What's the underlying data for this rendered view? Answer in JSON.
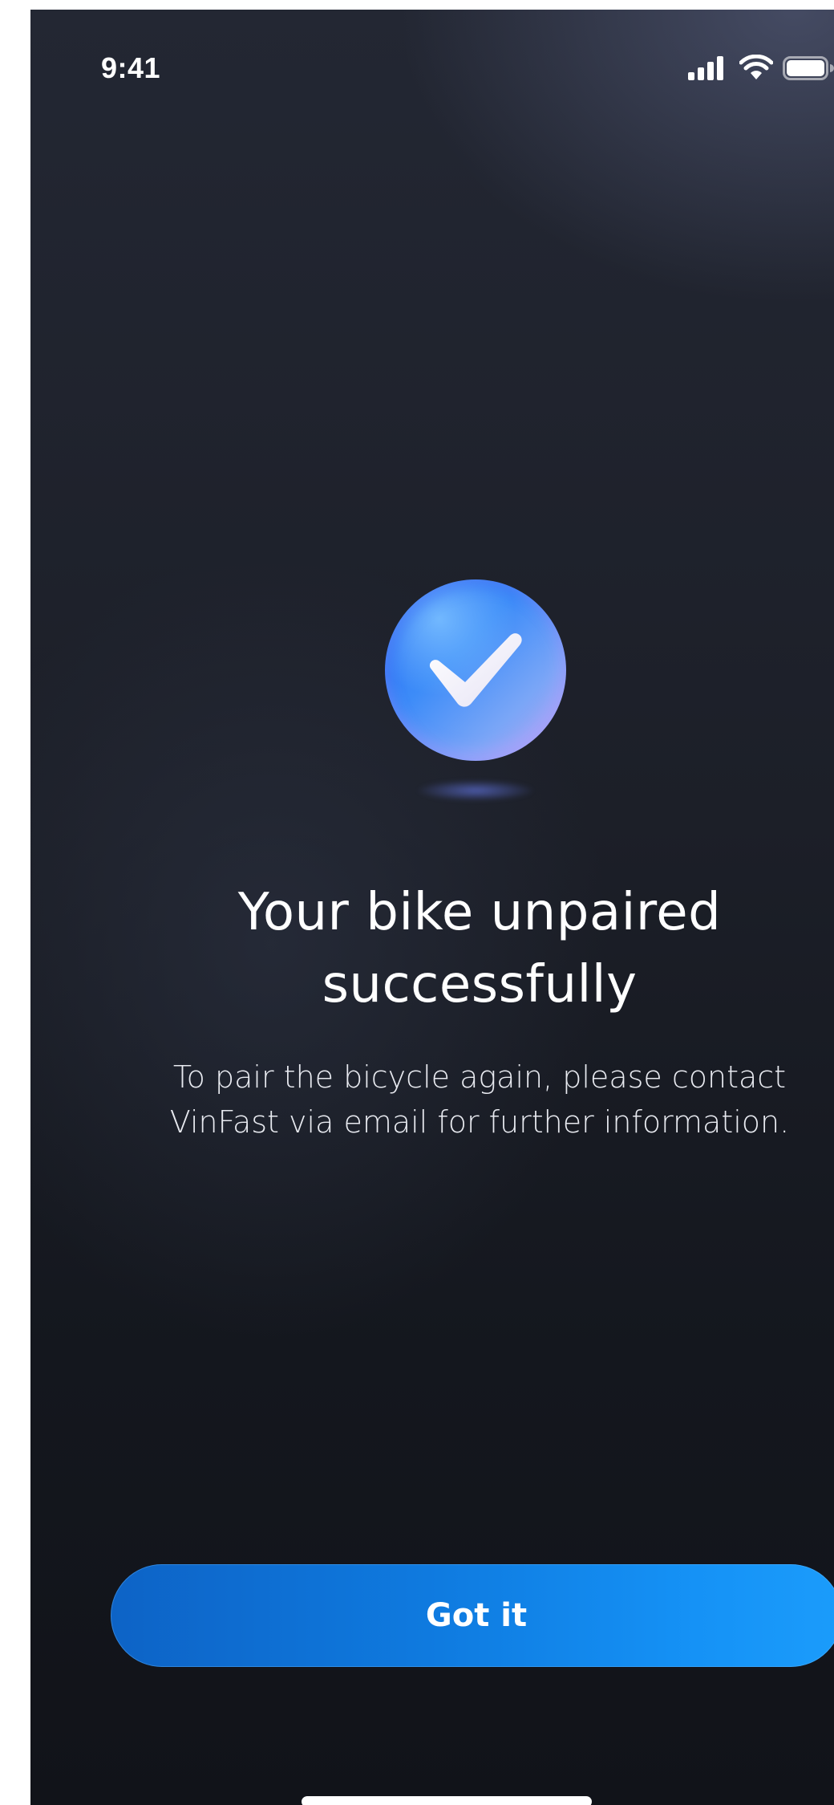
{
  "status_bar": {
    "time": "9:41",
    "icons": [
      "signal-icon",
      "wifi-icon",
      "battery-icon"
    ]
  },
  "success": {
    "icon": "check-circle-icon",
    "title": "Your bike unpaired successfully",
    "description": "To pair the bicycle again, please contact VinFast via email for further information."
  },
  "actions": {
    "primary_label": "Got it"
  },
  "colors": {
    "accent": "#1592f6",
    "background": "#1c1f28",
    "text": "#ffffff"
  }
}
